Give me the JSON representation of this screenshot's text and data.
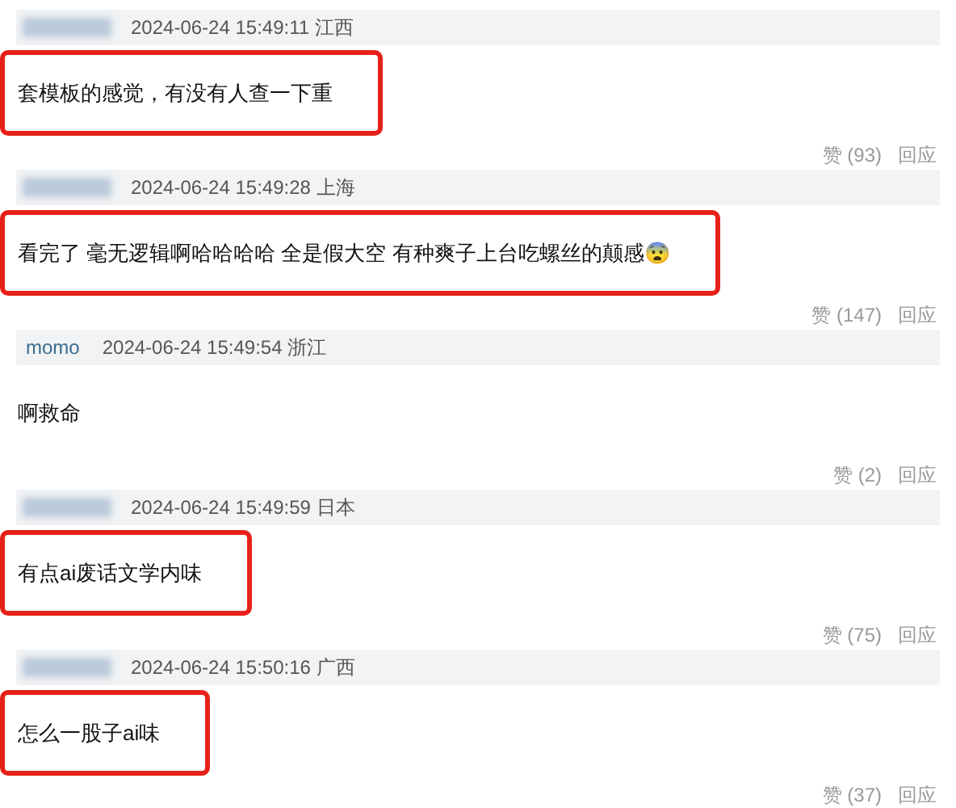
{
  "comments": [
    {
      "user": {
        "kind": "blurred"
      },
      "time": "2024-06-24 15:49:11",
      "location": "江西",
      "text": "套模板的感觉，有没有人查一下重",
      "highlighted": true,
      "likes": "赞 (93)",
      "reply": "回应"
    },
    {
      "user": {
        "kind": "blurred"
      },
      "time": "2024-06-24 15:49:28",
      "location": "上海",
      "text": "看完了 毫无逻辑啊哈哈哈哈 全是假大空 有种爽子上台吃螺丝的颠感😨",
      "highlighted": true,
      "likes": "赞 (147)",
      "reply": "回应"
    },
    {
      "user": {
        "kind": "name",
        "name": "momo"
      },
      "time": "2024-06-24 15:49:54",
      "location": "浙江",
      "text": "啊救命",
      "highlighted": false,
      "likes": "赞 (2)",
      "reply": "回应"
    },
    {
      "user": {
        "kind": "blurred"
      },
      "time": "2024-06-24 15:49:59",
      "location": "日本",
      "text": "有点ai废话文学内味",
      "highlighted": true,
      "likes": "赞 (75)",
      "reply": "回应"
    },
    {
      "user": {
        "kind": "blurred"
      },
      "time": "2024-06-24 15:50:16",
      "location": "广西",
      "text": "怎么一股子ai味",
      "highlighted": true,
      "likes": "赞 (37)",
      "reply": "回应"
    }
  ]
}
